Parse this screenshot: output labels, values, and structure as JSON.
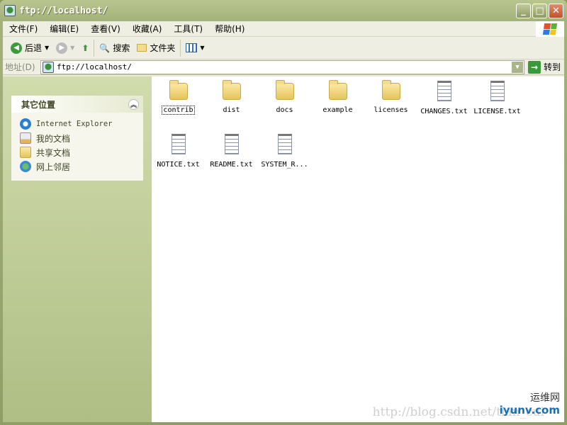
{
  "window": {
    "title": "ftp://localhost/"
  },
  "menu": [
    "文件(F)",
    "编辑(E)",
    "查看(V)",
    "收藏(A)",
    "工具(T)",
    "帮助(H)"
  ],
  "toolbar": {
    "back": "后退",
    "search": "搜索",
    "folders": "文件夹"
  },
  "address": {
    "label": "地址(D)",
    "value": "ftp://localhost/",
    "go": "转到"
  },
  "panel": {
    "title": "其它位置",
    "items": [
      "Internet Explorer",
      "我的文档",
      "共享文档",
      "网上邻居"
    ]
  },
  "files": [
    {
      "name": "contrib",
      "type": "folder"
    },
    {
      "name": "dist",
      "type": "folder"
    },
    {
      "name": "docs",
      "type": "folder"
    },
    {
      "name": "example",
      "type": "folder"
    },
    {
      "name": "licenses",
      "type": "folder"
    },
    {
      "name": "CHANGES.txt",
      "type": "text"
    },
    {
      "name": "LICENSE.txt",
      "type": "text"
    },
    {
      "name": "NOTICE.txt",
      "type": "text"
    },
    {
      "name": "README.txt",
      "type": "text"
    },
    {
      "name": "SYSTEM_R...",
      "type": "text"
    }
  ],
  "watermark": {
    "url": "http://blog.csdn.net/tian_cui",
    "logo_cn": "运维网",
    "logo_en": "iyunv.com"
  }
}
